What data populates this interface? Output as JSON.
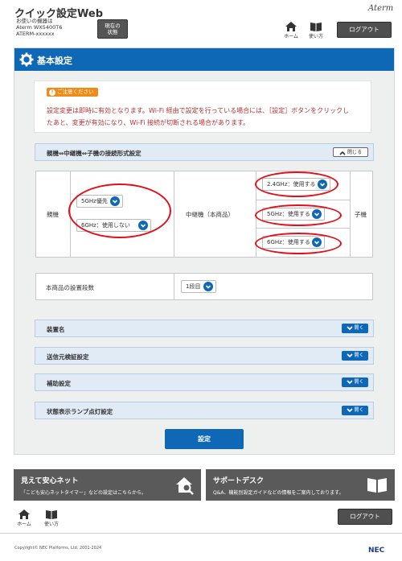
{
  "header": {
    "title": "クイック設定Web",
    "device_label": "お使いの機器は",
    "device_model": "Aterm WX5400T6",
    "device_name": "ATERM-xxxxxx",
    "status_button": [
      "現在の",
      "状態"
    ],
    "brand": "Aterm",
    "home_label": "ホーム",
    "help_label": "使い方",
    "logout_label": "ログアウト"
  },
  "panel": {
    "title": "基本設定",
    "notice": {
      "tag": "ご注意ください",
      "lines": [
        "設定変更は即時に有効となります。Wi-Fi 経由で設定を行っている場合には、［設定］ボタンをクリックし",
        "たあと、変更が有効になり、Wi-Fi 接続が切断される場合があります。"
      ]
    },
    "connection": {
      "section_label": "親機⇔中継機⇔子機の接続形式設定",
      "toggle_label": "閉じる",
      "parent_label": "親機",
      "parent_band_value": "5GHz優先",
      "parent_6ghz_value": "6GHz：使用しない",
      "repeater_label": "中継機（本商品）",
      "repeater_24_value": "2.4GHz：使用する",
      "repeater_5_value": "5GHz：使用する",
      "repeater_6_value": "6GHz：使用する",
      "child_label": "子機"
    },
    "stage": {
      "label": "本商品の設置段数",
      "value": "1段目"
    },
    "collapsed_sections": [
      {
        "label": "装置名",
        "toggle": "開く"
      },
      {
        "label": "送信元検証設定",
        "toggle": "開く"
      },
      {
        "label": "補助設定",
        "toggle": "開く"
      },
      {
        "label": "状態表示ランプ点灯設定",
        "toggle": "開く"
      }
    ],
    "set_button": "設定"
  },
  "banners": {
    "left": {
      "title": "見えて安心ネット",
      "sub": "「こども安心ネットタイマー」などの設定はこちらから。"
    },
    "right": {
      "title": "サポートデスク",
      "sub": "Q&A、機能別設定ガイドなどの情報をご案内しております。"
    }
  },
  "footer": {
    "home_label": "ホーム",
    "help_label": "使い方",
    "logout_label": "ログアウト",
    "copyright": "Copyright© NEC Platforms, Ltd. 2001-2024",
    "brand": "NEC"
  },
  "colors": {
    "accent": "#0e68b6",
    "warning": "#ef8b17",
    "alert_text": "#b43030",
    "highlight_ring": "#e3101a"
  },
  "icons": [
    "home-icon",
    "book-icon",
    "gear-icon",
    "chevron-down-icon",
    "chevron-up-icon",
    "house-search-icon",
    "info-icon"
  ]
}
